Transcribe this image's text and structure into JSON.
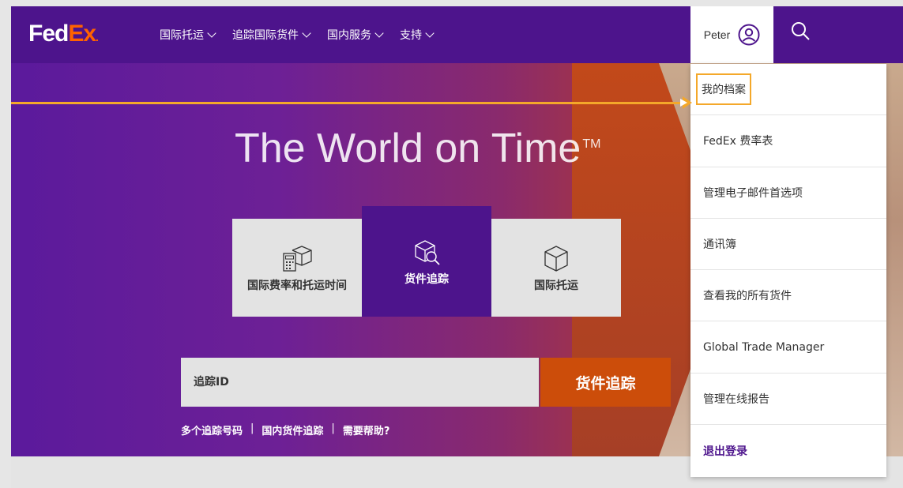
{
  "brand": {
    "logo_fed": "Fed",
    "logo_ex": "Ex",
    "logo_dot": "."
  },
  "nav": {
    "items": [
      {
        "label": "国际托运"
      },
      {
        "label": "追踪国际货件"
      },
      {
        "label": "国内服务"
      },
      {
        "label": "支持"
      }
    ]
  },
  "user": {
    "name": "Peter"
  },
  "hero": {
    "title": "The World on Time",
    "trademark": "TM",
    "tiles": [
      {
        "label": "国际费率和托运时间",
        "icon": "rates-calculator-icon",
        "active": false
      },
      {
        "label": "货件追踪",
        "icon": "package-search-icon",
        "active": true
      },
      {
        "label": "国际托运",
        "icon": "package-icon",
        "active": false
      }
    ],
    "tracking": {
      "placeholder": "追踪ID",
      "button_label": "货件追踪"
    },
    "quick_links": [
      {
        "label": "多个追踪号码"
      },
      {
        "label": "国内货件追踪"
      },
      {
        "label": "需要帮助?"
      }
    ],
    "separator": "|"
  },
  "dropdown": {
    "items": [
      {
        "label": "我的档案",
        "highlighted": true
      },
      {
        "label": "FedEx 费率表"
      },
      {
        "label": "管理电子邮件首选项"
      },
      {
        "label": "通讯簿"
      },
      {
        "label": "查看我的所有货件"
      },
      {
        "label": "Global Trade Manager"
      },
      {
        "label": "管理在线报告"
      },
      {
        "label": "退出登录"
      }
    ]
  },
  "colors": {
    "brand_purple": "#4d148c",
    "brand_orange": "#ff6200",
    "track_button": "#cc4d0a",
    "annotation": "#f4a82a"
  }
}
